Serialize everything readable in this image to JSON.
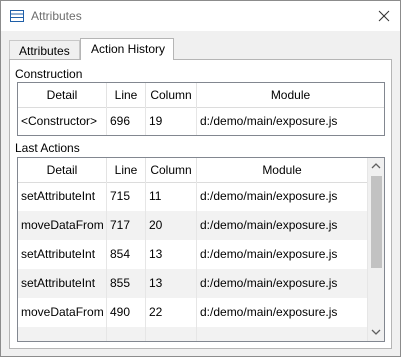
{
  "window": {
    "title": "Attributes"
  },
  "tabs": [
    {
      "label": "Attributes",
      "active": false
    },
    {
      "label": "Action History",
      "active": true
    }
  ],
  "construction": {
    "label": "Construction",
    "columns": [
      "Detail",
      "Line",
      "Column",
      "Module"
    ],
    "rows": [
      {
        "detail": "<Constructor>",
        "line": "696",
        "column": "19",
        "module": "d:/demo/main/exposure.js"
      }
    ]
  },
  "last_actions": {
    "label": "Last Actions",
    "columns": [
      "Detail",
      "Line",
      "Column",
      "Module"
    ],
    "rows": [
      {
        "detail": "setAttributeInt",
        "line": "715",
        "column": "11",
        "module": "d:/demo/main/exposure.js"
      },
      {
        "detail": "moveDataFrom",
        "line": "717",
        "column": "20",
        "module": "d:/demo/main/exposure.js"
      },
      {
        "detail": "setAttributeInt",
        "line": "854",
        "column": "13",
        "module": "d:/demo/main/exposure.js"
      },
      {
        "detail": "setAttributeInt",
        "line": "855",
        "column": "13",
        "module": "d:/demo/main/exposure.js"
      },
      {
        "detail": "moveDataFrom",
        "line": "490",
        "column": "22",
        "module": "d:/demo/main/exposure.js"
      }
    ]
  },
  "icons": {
    "app": "list-icon",
    "close": "close-icon",
    "scroll_up": "chevron-up-icon",
    "scroll_down": "chevron-down-icon"
  },
  "colors": {
    "title_text": "#6d6d6d",
    "alt_row": "#f2f2f2",
    "scroll_thumb": "#c2c2c2",
    "grid_border": "#828790"
  }
}
